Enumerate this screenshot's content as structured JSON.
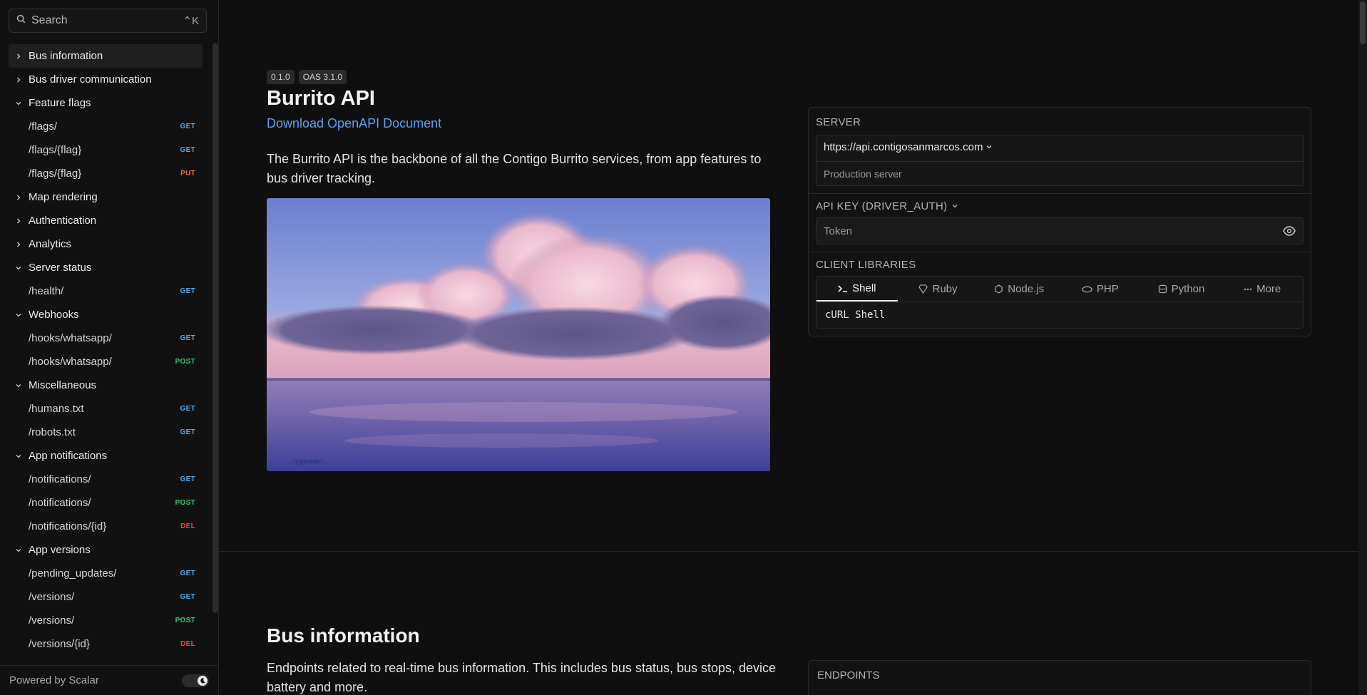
{
  "search": {
    "placeholder": "Search",
    "shortcut": "⌃K"
  },
  "sidebar": {
    "items": [
      {
        "type": "group",
        "label": "Bus information",
        "expanded": false,
        "active": true
      },
      {
        "type": "group",
        "label": "Bus driver communication",
        "expanded": false
      },
      {
        "type": "group",
        "label": "Feature flags",
        "expanded": true
      },
      {
        "type": "endpoint",
        "label": "/flags/",
        "method": "GET"
      },
      {
        "type": "endpoint",
        "label": "/flags/{flag}",
        "method": "GET"
      },
      {
        "type": "endpoint",
        "label": "/flags/{flag}",
        "method": "PUT"
      },
      {
        "type": "group",
        "label": "Map rendering",
        "expanded": false
      },
      {
        "type": "group",
        "label": "Authentication",
        "expanded": false
      },
      {
        "type": "group",
        "label": "Analytics",
        "expanded": false
      },
      {
        "type": "group",
        "label": "Server status",
        "expanded": true
      },
      {
        "type": "endpoint",
        "label": "/health/",
        "method": "GET"
      },
      {
        "type": "group",
        "label": "Webhooks",
        "expanded": true
      },
      {
        "type": "endpoint",
        "label": "/hooks/whatsapp/",
        "method": "GET"
      },
      {
        "type": "endpoint",
        "label": "/hooks/whatsapp/",
        "method": "POST"
      },
      {
        "type": "group",
        "label": "Miscellaneous",
        "expanded": true
      },
      {
        "type": "endpoint",
        "label": "/humans.txt",
        "method": "GET"
      },
      {
        "type": "endpoint",
        "label": "/robots.txt",
        "method": "GET"
      },
      {
        "type": "group",
        "label": "App notifications",
        "expanded": true
      },
      {
        "type": "endpoint",
        "label": "/notifications/",
        "method": "GET"
      },
      {
        "type": "endpoint",
        "label": "/notifications/",
        "method": "POST"
      },
      {
        "type": "endpoint",
        "label": "/notifications/{id}",
        "method": "DEL"
      },
      {
        "type": "group",
        "label": "App versions",
        "expanded": true
      },
      {
        "type": "endpoint",
        "label": "/pending_updates/",
        "method": "GET"
      },
      {
        "type": "endpoint",
        "label": "/versions/",
        "method": "GET"
      },
      {
        "type": "endpoint",
        "label": "/versions/",
        "method": "POST"
      },
      {
        "type": "endpoint",
        "label": "/versions/{id}",
        "method": "DEL"
      }
    ],
    "footer": "Powered by Scalar"
  },
  "colors": {
    "GET": "#5aa7e6",
    "PUT": "#f47046",
    "POST": "#39c36e",
    "DEL": "#e24a4a",
    "link": "#5ba0f2"
  },
  "main": {
    "version_badge": "0.1.0",
    "oas_badge": "OAS 3.1.0",
    "title": "Burrito API",
    "download_link": "Download OpenAPI Document",
    "description": "The Burrito API is the backbone of all the Contigo Burrito services, from app features to bus driver tracking."
  },
  "panel": {
    "server_label": "SERVER",
    "server_url": "https://api.contigosanmarcos.com",
    "server_description": "Production server",
    "auth_label": "API KEY (DRIVER_AUTH)",
    "token_placeholder": "Token",
    "libraries_label": "CLIENT LIBRARIES",
    "tabs": [
      {
        "label": "Shell",
        "icon": "terminal-icon",
        "active": true
      },
      {
        "label": "Ruby",
        "icon": "ruby-icon"
      },
      {
        "label": "Node.js",
        "icon": "nodejs-icon"
      },
      {
        "label": "PHP",
        "icon": "php-icon"
      },
      {
        "label": "Python",
        "icon": "python-icon"
      },
      {
        "label": "More",
        "icon": "more-icon"
      }
    ],
    "code_label": "cURL Shell"
  },
  "section": {
    "title": "Bus information",
    "description": "Endpoints related to real-time bus information. This includes bus status, bus stops, device battery and more.",
    "endpoints_label": "ENDPOINTS"
  }
}
